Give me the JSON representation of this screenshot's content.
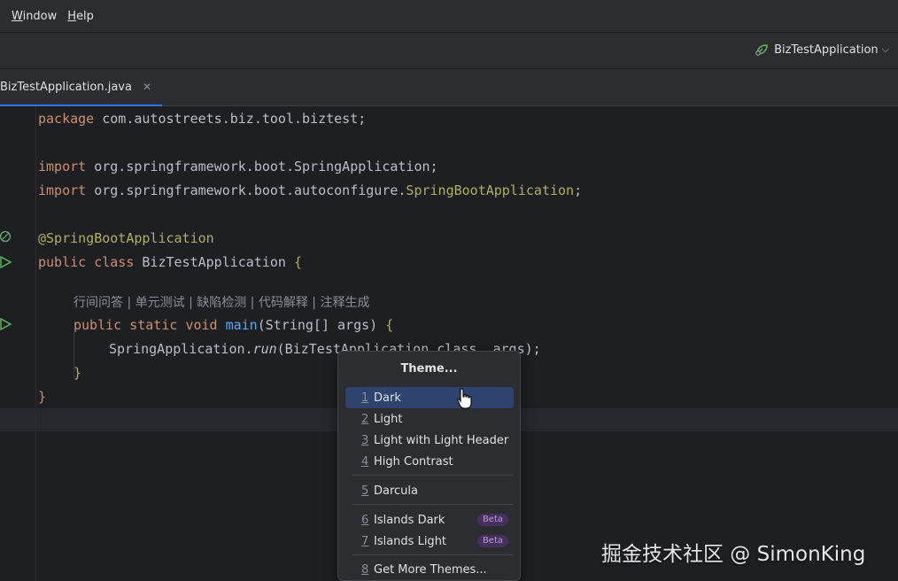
{
  "menubar": {
    "items": [
      {
        "label": "Window",
        "mnemonic": "W",
        "rest": "indow"
      },
      {
        "label": "Help",
        "mnemonic": "H",
        "rest": "elp"
      }
    ]
  },
  "toolbar": {
    "run_config": "BizTestApplication",
    "run_icon": "spring-leaf-icon"
  },
  "tabs": [
    {
      "label": "BizTestApplication.java",
      "close_icon": "close-icon",
      "active": true
    }
  ],
  "editor": {
    "lines": {
      "package_kw": "package",
      "package_name": " com.autostreets.biz.tool.biztest;",
      "import_kw": "import",
      "import1": " org.springframework.boot.SpringApplication;",
      "import2_prefix": " org.springframework.boot.autoconfigure.",
      "import2_class": "SpringBootApplication",
      "import2_suffix": ";",
      "annotation": "@SpringBootApplication",
      "public_kw": "public",
      "class_kw": " class",
      "class_name": " BizTestApplication ",
      "open_brace": "{",
      "static_kw": " static",
      "void_kw": " void",
      "main_fn": " main",
      "main_args": "(String[] args) ",
      "run_prefix": "SpringApplication.",
      "run_fn": "run",
      "run_args": "(BizTestApplication.class, args);",
      "close_brace": "}"
    },
    "inlay_hint": "行间问答 | 单元测试 | 缺陷检测 | 代码解释 | 注释生成"
  },
  "theme_popup": {
    "title": "Theme...",
    "items": [
      {
        "num": "1",
        "label": "Dark",
        "selected": true
      },
      {
        "num": "2",
        "label": "Light"
      },
      {
        "num": "3",
        "label": "Light with Light Header"
      },
      {
        "num": "4",
        "label": "High Contrast"
      },
      {
        "num": "5",
        "label": "Darcula"
      },
      {
        "num": "6",
        "label": "Islands Dark",
        "badge": "Beta"
      },
      {
        "num": "7",
        "label": "Islands Light",
        "badge": "Beta"
      },
      {
        "num": "8",
        "label": "Get More Themes..."
      }
    ]
  },
  "watermark": "掘金技术社区 @ SimonKing",
  "colors": {
    "accent": "#3574f0",
    "selected_item": "#2e436e",
    "keyword": "#cf8e6d",
    "annotation": "#b3ae60",
    "function": "#56a8f5",
    "beta_badge": "#45305e"
  }
}
